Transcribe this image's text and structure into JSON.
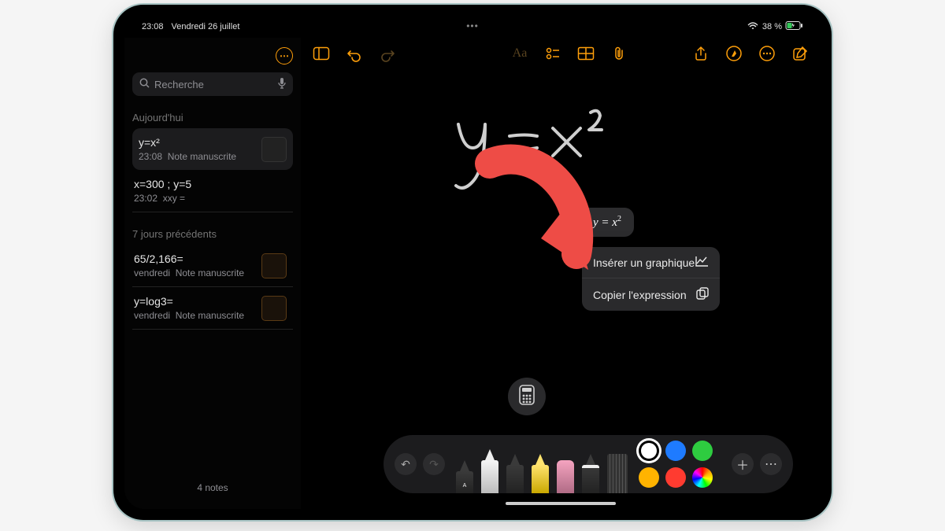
{
  "status": {
    "time": "23:08",
    "date": "Vendredi 26 juillet",
    "battery": "38 %"
  },
  "sidebar": {
    "search_placeholder": "Recherche",
    "sections": [
      {
        "header": "Aujourd'hui",
        "notes": [
          {
            "title": "y=x²",
            "time": "23:08",
            "sub": "Note manuscrite",
            "selected": true
          },
          {
            "title": "x=300 ; y=5",
            "time": "23:02",
            "sub": "xxy ="
          }
        ]
      },
      {
        "header": "7 jours précédents",
        "notes": [
          {
            "title": "65/2,166=",
            "time": "vendredi",
            "sub": "Note manuscrite",
            "thumb": "orange"
          },
          {
            "title": "y=log3=",
            "time": "vendredi",
            "sub": "Note manuscrite",
            "thumb": "orange"
          }
        ]
      }
    ],
    "count": "4 notes"
  },
  "chart_data": {
    "type": "handwriting",
    "expression_raw": "y = x²",
    "recognized": "y = x²",
    "variables": [
      "x",
      "y"
    ]
  },
  "expression": {
    "lhs": "y",
    "rhs": "x",
    "exp": "2"
  },
  "menu": {
    "insert_graph": "Insérer un graphique",
    "copy_expr": "Copier l'expression"
  },
  "palette": {
    "colors": [
      "#ffffff",
      "#1e7bff",
      "#2ecc40",
      "#ffb300",
      "#ff3b30"
    ]
  }
}
